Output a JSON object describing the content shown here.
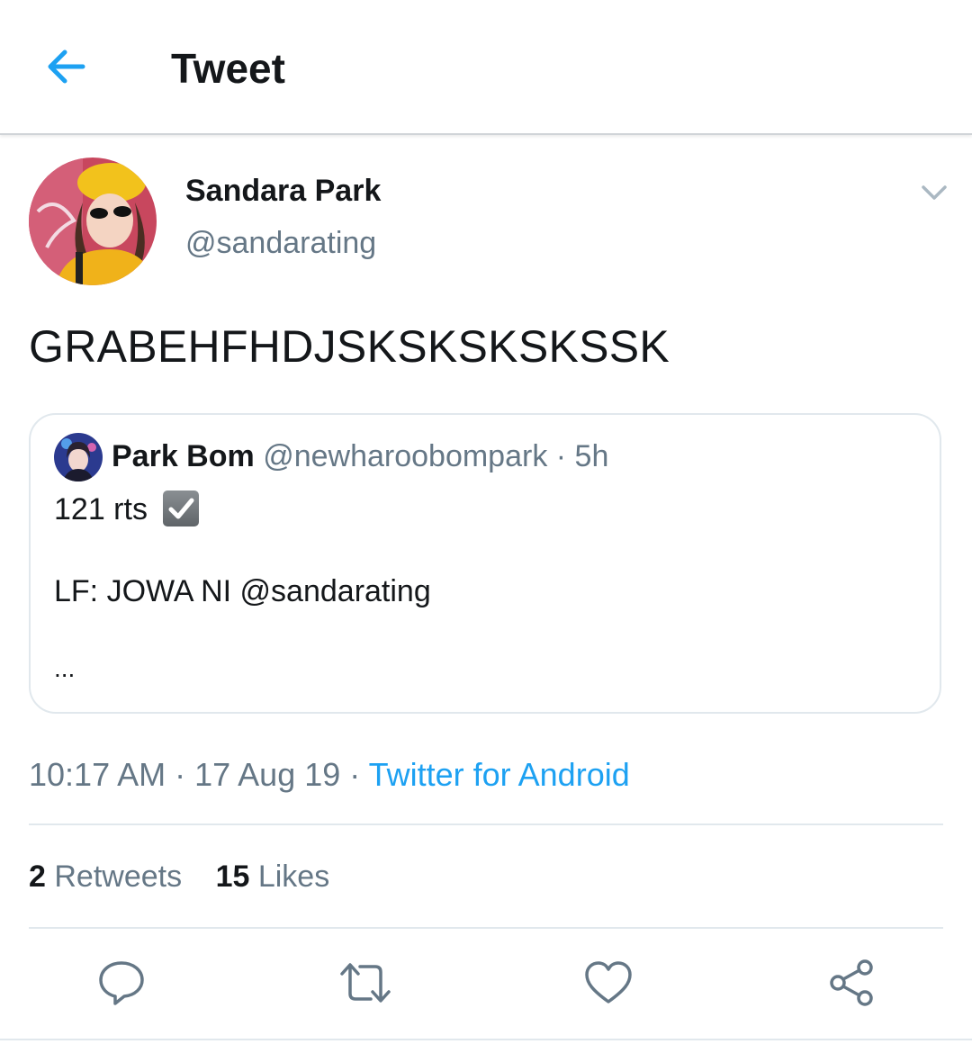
{
  "header": {
    "title": "Tweet",
    "back_icon": "arrow-left-icon"
  },
  "tweet": {
    "author_name": "Sandara Park",
    "author_handle": "@sandarating",
    "text": "GRABEHFHDJSKSKSKSKSSK",
    "timestamp": "10:17 AM · 17 Aug 19 · ",
    "source": "Twitter for Android"
  },
  "quote": {
    "author_name": "Park Bom",
    "author_handle": "@newharoobompark",
    "age": " · 5h",
    "line1": "121 rts",
    "line2": "LF: JOWA NI @sandarating",
    "ellipsis": "..."
  },
  "stats": {
    "retweets_count": "2",
    "retweets_label": "Retweets",
    "likes_count": "15",
    "likes_label": "Likes"
  },
  "actions": [
    "reply-icon",
    "retweet-icon",
    "like-icon",
    "share-icon"
  ],
  "colors": {
    "accent": "#1da1f2",
    "secondary_text": "#657786",
    "divider": "#e1e8ed"
  }
}
